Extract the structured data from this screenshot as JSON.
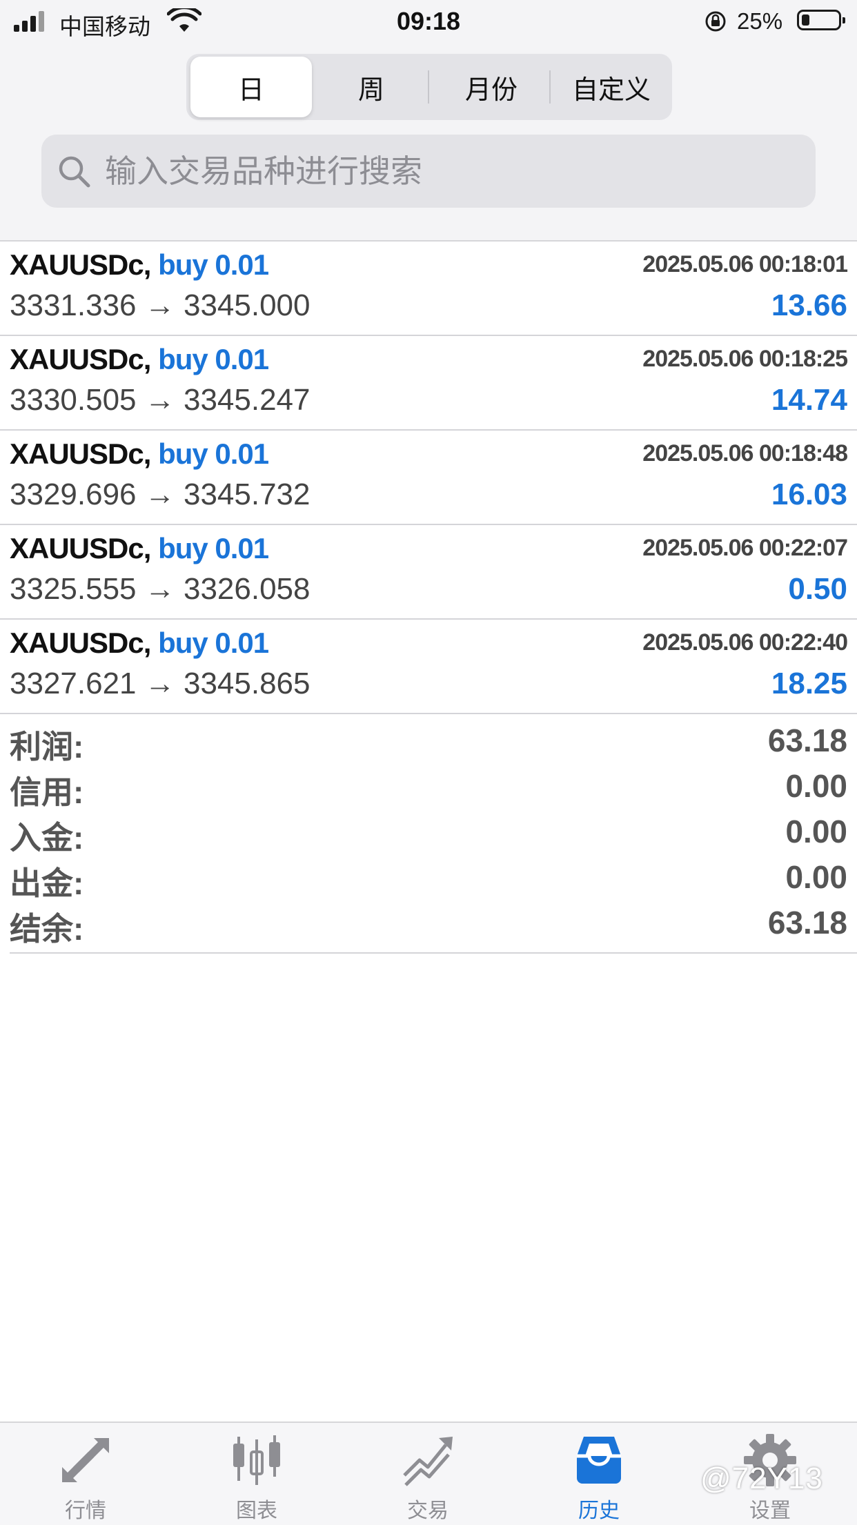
{
  "status_bar": {
    "carrier": "中国移动",
    "time": "09:18",
    "battery": "25%",
    "battery_level": 0.25
  },
  "period_tabs": [
    {
      "label": "日",
      "active": true
    },
    {
      "label": "周",
      "active": false
    },
    {
      "label": "月份",
      "active": false
    },
    {
      "label": "自定义",
      "active": false
    }
  ],
  "search": {
    "placeholder": "输入交易品种进行搜索"
  },
  "deals": [
    {
      "symbol": "XAUUSDc,",
      "trade": "buy 0.01",
      "time": "2025.05.06 00:18:01",
      "prices": "3331.336 → 3345.000",
      "profit": "13.66"
    },
    {
      "symbol": "XAUUSDc,",
      "trade": "buy 0.01",
      "time": "2025.05.06 00:18:25",
      "prices": "3330.505 → 3345.247",
      "profit": "14.74"
    },
    {
      "symbol": "XAUUSDc,",
      "trade": "buy 0.01",
      "time": "2025.05.06 00:18:48",
      "prices": "3329.696 → 3345.732",
      "profit": "16.03"
    },
    {
      "symbol": "XAUUSDc,",
      "trade": "buy 0.01",
      "time": "2025.05.06 00:22:07",
      "prices": "3325.555 → 3326.058",
      "profit": "0.50"
    },
    {
      "symbol": "XAUUSDc,",
      "trade": "buy 0.01",
      "time": "2025.05.06 00:22:40",
      "prices": "3327.621 → 3345.865",
      "profit": "18.25"
    }
  ],
  "summary": [
    {
      "label": "利润:",
      "value": "63.18"
    },
    {
      "label": "信用:",
      "value": "0.00"
    },
    {
      "label": "入金:",
      "value": "0.00"
    },
    {
      "label": "出金:",
      "value": "0.00"
    },
    {
      "label": "结余:",
      "value": "63.18"
    }
  ],
  "tab_bar": [
    {
      "label": "行情",
      "icon": "quotes-arrows-icon",
      "active": false
    },
    {
      "label": "图表",
      "icon": "chart-candles-icon",
      "active": false
    },
    {
      "label": "交易",
      "icon": "trade-trend-icon",
      "active": false
    },
    {
      "label": "历史",
      "icon": "history-inbox-icon",
      "active": true
    },
    {
      "label": "设置",
      "icon": "settings-gear-icon",
      "active": false
    }
  ],
  "watermark": "@72Y13",
  "colors": {
    "accent_blue": "#1a74d8",
    "inactive_gray": "#8e8e93",
    "background_gray": "#f4f4f6"
  }
}
